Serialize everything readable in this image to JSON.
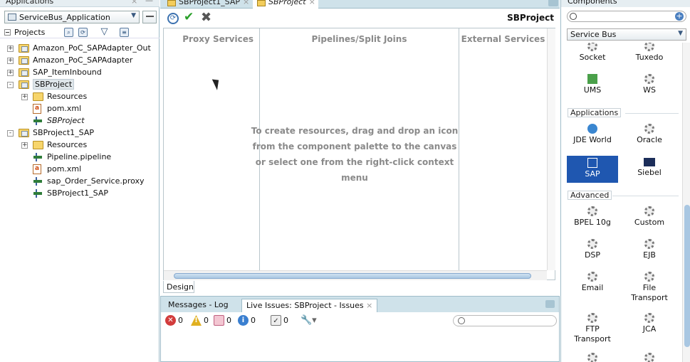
{
  "left": {
    "header": "Applications",
    "app_selector": "ServiceBus_Application",
    "projects_label": "Projects",
    "tree": [
      {
        "label": "Amazon_PoC_SAPAdapter_Out",
        "depth": 0,
        "type": "project",
        "expand": "+"
      },
      {
        "label": "Amazon_PoC_SAPAdapter",
        "depth": 0,
        "type": "project",
        "expand": "+"
      },
      {
        "label": "SAP_ItemInbound",
        "depth": 0,
        "type": "project",
        "expand": "+"
      },
      {
        "label": "SBProject",
        "depth": 0,
        "type": "project",
        "expand": "-",
        "selected": true
      },
      {
        "label": "Resources",
        "depth": 1,
        "type": "folder",
        "expand": "+"
      },
      {
        "label": "pom.xml",
        "depth": 1,
        "type": "file"
      },
      {
        "label": "SBProject",
        "depth": 1,
        "type": "sb",
        "italic": true
      },
      {
        "label": "SBProject1_SAP",
        "depth": 0,
        "type": "project",
        "expand": "-"
      },
      {
        "label": "Resources",
        "depth": 1,
        "type": "folder",
        "expand": "+"
      },
      {
        "label": "Pipeline.pipeline",
        "depth": 1,
        "type": "pipeline"
      },
      {
        "label": "pom.xml",
        "depth": 1,
        "type": "file"
      },
      {
        "label": "sap_Order_Service.proxy",
        "depth": 1,
        "type": "proxy"
      },
      {
        "label": "SBProject1_SAP",
        "depth": 1,
        "type": "sb"
      }
    ]
  },
  "editor": {
    "tabs": [
      {
        "label": "SBProject1_SAP",
        "active": false
      },
      {
        "label": "SBProject",
        "active": true
      }
    ],
    "title": "SBProject",
    "columns": [
      "Proxy Services",
      "Pipelines/Split Joins",
      "External Services"
    ],
    "hint": [
      "To create resources, drag and drop an icon",
      "from the component palette to the canvas",
      "or select one from the right-click context menu"
    ],
    "design_tab": "Design"
  },
  "bottom": {
    "tabs": [
      "Messages - Log",
      "Live Issues: SBProject - Issues"
    ],
    "filters": [
      {
        "icon": "error-icon",
        "count": "0",
        "color": "#d23c3c"
      },
      {
        "icon": "warning-icon",
        "count": "0",
        "color": "#e0b020"
      },
      {
        "icon": "incomplete-icon",
        "count": "0",
        "color": "#d08090"
      },
      {
        "icon": "info-icon",
        "count": "0",
        "color": "#3a7fd0"
      },
      {
        "icon": "task-icon",
        "count": "0",
        "color": "#888888"
      }
    ]
  },
  "right": {
    "header": "Components",
    "palette": "Service Bus",
    "top_items": [
      "Socket",
      "Tuxedo",
      "UMS",
      "WS"
    ],
    "applications_label": "Applications",
    "app_items": [
      "JDE World",
      "Oracle",
      "SAP",
      "Siebel"
    ],
    "advanced_label": "Advanced",
    "adv_items": [
      "BPEL 10g",
      "Custom",
      "DSP",
      "EJB",
      "Email",
      "File\nTransport",
      "FTP\nTransport",
      "JCA"
    ]
  }
}
